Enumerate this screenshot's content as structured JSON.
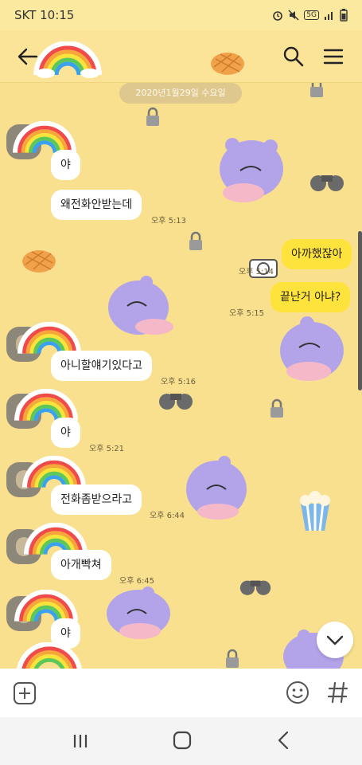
{
  "status_bar": {
    "carrier_time": "SKT 10:15",
    "network": "5G"
  },
  "header": {},
  "chat": {
    "date": "2020년1월29일 수요일",
    "messages": [
      {
        "sender": "other",
        "text": "야",
        "time": ""
      },
      {
        "sender": "other",
        "text": "왜전화안받는데",
        "time": "오후 5:13"
      },
      {
        "sender": "me",
        "text": "아까했잖아",
        "time": "오후 5:14"
      },
      {
        "sender": "me",
        "text": "끝난거 아냐?",
        "time": "오후 5:15"
      },
      {
        "sender": "other",
        "text": "아니할얘기있다고",
        "time": "오후 5:16"
      },
      {
        "sender": "other",
        "text": "야",
        "time": "오후 5:21"
      },
      {
        "sender": "other",
        "text": "전화좀받으라고",
        "time": "오후 6:44"
      },
      {
        "sender": "other",
        "text": "아개빡쳐",
        "time": "오후 6:45"
      },
      {
        "sender": "other",
        "text": "야",
        "time": ""
      }
    ]
  },
  "input_bar": {
    "add_icon": "plus-icon",
    "emoji_icon": "emoticon-icon",
    "hash_icon": "hash-icon"
  },
  "nav_bar": {
    "icons": [
      "recents-icon",
      "home-icon",
      "back-icon"
    ]
  }
}
